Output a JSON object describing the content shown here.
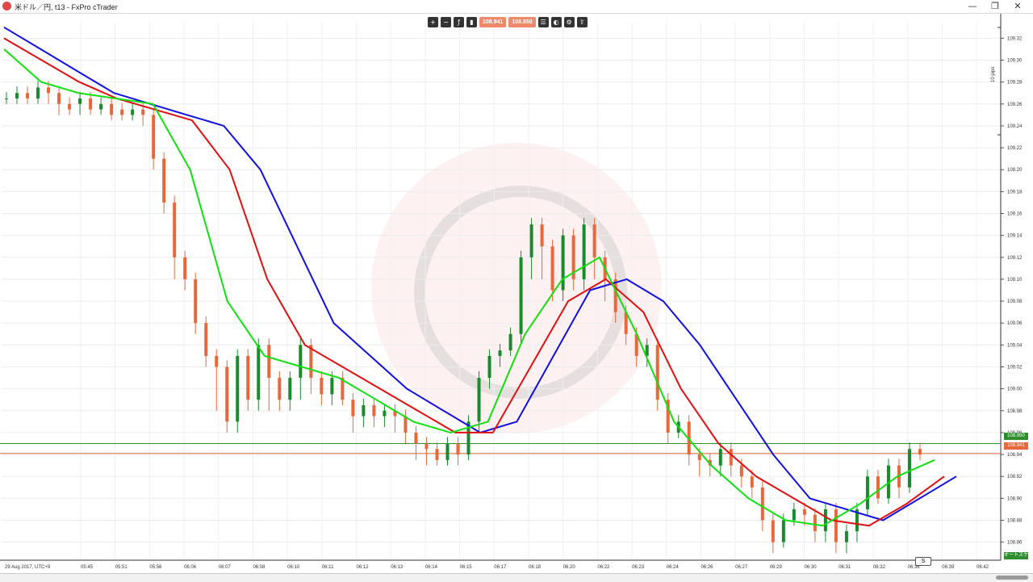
{
  "window": {
    "title": "米ドル／円, t13 - FxPro cTrader",
    "minimize": "—",
    "restore": "❐",
    "close": "✕"
  },
  "toolbar": {
    "icons": [
      "zoom-in-icon",
      "zoom-out-icon",
      "indicator-icon",
      "chart-type-icon"
    ],
    "sell_price": "108.941",
    "buy_price": "108.950",
    "right_icons": [
      "list-icon",
      "sentiment-icon",
      "settings-icon",
      "share-icon"
    ]
  },
  "price_axis": {
    "labels": [
      "109.32",
      "109.30",
      "109.28",
      "109.26",
      "109.24",
      "109.22",
      "109.20",
      "109.18",
      "109.16",
      "109.14",
      "109.12",
      "109.10",
      "109.08",
      "109.06",
      "109.04",
      "109.02",
      "109.00",
      "108.98",
      "108.96",
      "108.94",
      "108.92",
      "108.90",
      "108.88",
      "108.86"
    ],
    "ask_tag": "108.950",
    "bid_tag": "108.941",
    "ask_color": "#2f8f2f",
    "bid_color": "#e8683c",
    "scale_note": "10 pips",
    "bottom_tag": "オートスケール"
  },
  "time_axis": {
    "labels": [
      "29 Aug 2017, UTC+9",
      "05:45",
      "05:51",
      "05:56",
      "06:06",
      "06:07",
      "06:08",
      "06:10",
      "06:11",
      "06:12",
      "06:13",
      "06:14",
      "06:15",
      "06:17",
      "06:18",
      "06:20",
      "06:22",
      "06:23",
      "06:24",
      "06:26",
      "06:27",
      "06:29",
      "06:30",
      "06:31",
      "06:32",
      "06:36",
      "06:39",
      "06:42"
    ],
    "s_button": "S"
  },
  "chart_data": {
    "type": "candlestick",
    "symbol": "米ドル／円",
    "timeframe": "t13",
    "ylim": [
      108.845,
      109.335
    ],
    "candles": [
      [
        109.265,
        109.265,
        109.26
      ],
      [
        109.265,
        109.27,
        109.26
      ],
      [
        109.27,
        109.265,
        109.26
      ],
      [
        109.265,
        109.275,
        109.26
      ],
      [
        109.275,
        109.27,
        109.26
      ],
      [
        109.27,
        109.26,
        109.25
      ],
      [
        109.26,
        109.255,
        109.25
      ],
      [
        109.26,
        109.265,
        109.25
      ],
      [
        109.265,
        109.255,
        109.25
      ],
      [
        109.255,
        109.26,
        109.25
      ],
      [
        109.26,
        109.25,
        109.245
      ],
      [
        109.255,
        109.25,
        109.245
      ],
      [
        109.25,
        109.255,
        109.245
      ],
      [
        109.255,
        109.25,
        109.24
      ],
      [
        109.25,
        109.21,
        109.2
      ],
      [
        109.21,
        109.17,
        109.16
      ],
      [
        109.17,
        109.12,
        109.1
      ],
      [
        109.12,
        109.1,
        109.09
      ],
      [
        109.1,
        109.06,
        109.05
      ],
      [
        109.06,
        109.03,
        109.02
      ],
      [
        109.03,
        109.02,
        108.98
      ],
      [
        109.02,
        108.97,
        108.96
      ],
      [
        108.97,
        109.03,
        108.96
      ],
      [
        109.03,
        108.99,
        108.98
      ],
      [
        108.99,
        109.04,
        108.98
      ],
      [
        109.04,
        109.01,
        108.98
      ],
      [
        109.01,
        108.99,
        108.98
      ],
      [
        108.99,
        109.01,
        108.98
      ],
      [
        109.01,
        109.04,
        108.99
      ],
      [
        109.04,
        109.01,
        108.995
      ],
      [
        109.01,
        108.995,
        108.985
      ],
      [
        108.995,
        109.01,
        108.985
      ],
      [
        109.01,
        108.99,
        108.985
      ],
      [
        108.99,
        108.975,
        108.96
      ],
      [
        108.975,
        108.985,
        108.965
      ],
      [
        108.985,
        108.975,
        108.965
      ],
      [
        108.975,
        108.98,
        108.965
      ],
      [
        108.98,
        108.975,
        108.96
      ],
      [
        108.975,
        108.96,
        108.95
      ],
      [
        108.96,
        108.95,
        108.935
      ],
      [
        108.95,
        108.945,
        108.93
      ],
      [
        108.945,
        108.935,
        108.93
      ],
      [
        108.935,
        108.95,
        108.93
      ],
      [
        108.95,
        108.94,
        108.93
      ],
      [
        108.94,
        108.97,
        108.935
      ],
      [
        108.97,
        109.01,
        108.96
      ],
      [
        109.01,
        109.03,
        109.0
      ],
      [
        109.03,
        109.035,
        109.02
      ],
      [
        109.035,
        109.05,
        109.03
      ],
      [
        109.05,
        109.12,
        109.04
      ],
      [
        109.12,
        109.15,
        109.1
      ],
      [
        109.15,
        109.13,
        109.1
      ],
      [
        109.13,
        109.09,
        109.08
      ],
      [
        109.09,
        109.14,
        109.08
      ],
      [
        109.14,
        109.1,
        109.09
      ],
      [
        109.1,
        109.15,
        109.09
      ],
      [
        109.15,
        109.12,
        109.1
      ],
      [
        109.12,
        109.1,
        109.08
      ],
      [
        109.1,
        109.07,
        109.06
      ],
      [
        109.07,
        109.05,
        109.04
      ],
      [
        109.05,
        109.03,
        109.02
      ],
      [
        109.03,
        109.04,
        109.02
      ],
      [
        109.04,
        108.99,
        108.98
      ],
      [
        108.99,
        108.96,
        108.95
      ],
      [
        108.96,
        108.97,
        108.955
      ],
      [
        108.97,
        108.94,
        108.93
      ],
      [
        108.94,
        108.935,
        108.92
      ],
      [
        108.935,
        108.93,
        108.92
      ],
      [
        108.93,
        108.945,
        108.92
      ],
      [
        108.945,
        108.93,
        108.92
      ],
      [
        108.93,
        108.92,
        108.91
      ],
      [
        108.92,
        108.91,
        108.9
      ],
      [
        108.91,
        108.88,
        108.87
      ],
      [
        108.88,
        108.86,
        108.85
      ],
      [
        108.86,
        108.88,
        108.855
      ],
      [
        108.88,
        108.89,
        108.875
      ],
      [
        108.89,
        108.885,
        108.875
      ],
      [
        108.885,
        108.87,
        108.86
      ],
      [
        108.87,
        108.89,
        108.86
      ],
      [
        108.89,
        108.86,
        108.85
      ],
      [
        108.86,
        108.87,
        108.85
      ],
      [
        108.87,
        108.89,
        108.86
      ],
      [
        108.89,
        108.92,
        108.885
      ],
      [
        108.92,
        108.9,
        108.895
      ],
      [
        108.9,
        108.93,
        108.895
      ],
      [
        108.93,
        108.91,
        108.9
      ],
      [
        108.91,
        108.945,
        108.905
      ],
      [
        108.945,
        108.94,
        108.935
      ]
    ],
    "series": [
      {
        "color": "#1010e0",
        "values": [
          109.33,
          109.31,
          109.29,
          109.27,
          109.26,
          109.25,
          109.24,
          109.2,
          109.13,
          109.06,
          109.03,
          109.0,
          108.98,
          108.96,
          108.97,
          109.03,
          109.09,
          109.1,
          109.08,
          109.04,
          108.99,
          108.94,
          108.9,
          108.89,
          108.88,
          108.9,
          108.92
        ]
      },
      {
        "color": "#e01010",
        "values": [
          109.32,
          109.3,
          109.28,
          109.265,
          109.255,
          109.245,
          109.2,
          109.1,
          109.04,
          109.02,
          109.0,
          108.98,
          108.96,
          108.96,
          109.02,
          109.08,
          109.1,
          109.07,
          109.0,
          108.95,
          108.92,
          108.9,
          108.88,
          108.875,
          108.895,
          108.92
        ]
      },
      {
        "color": "#10e010",
        "values": [
          109.31,
          109.28,
          109.27,
          109.265,
          109.26,
          109.2,
          109.08,
          109.03,
          109.02,
          109.01,
          108.99,
          108.97,
          108.96,
          108.97,
          109.05,
          109.1,
          109.12,
          109.05,
          108.97,
          108.93,
          108.9,
          108.88,
          108.875,
          108.895,
          108.92,
          108.935
        ]
      }
    ]
  }
}
